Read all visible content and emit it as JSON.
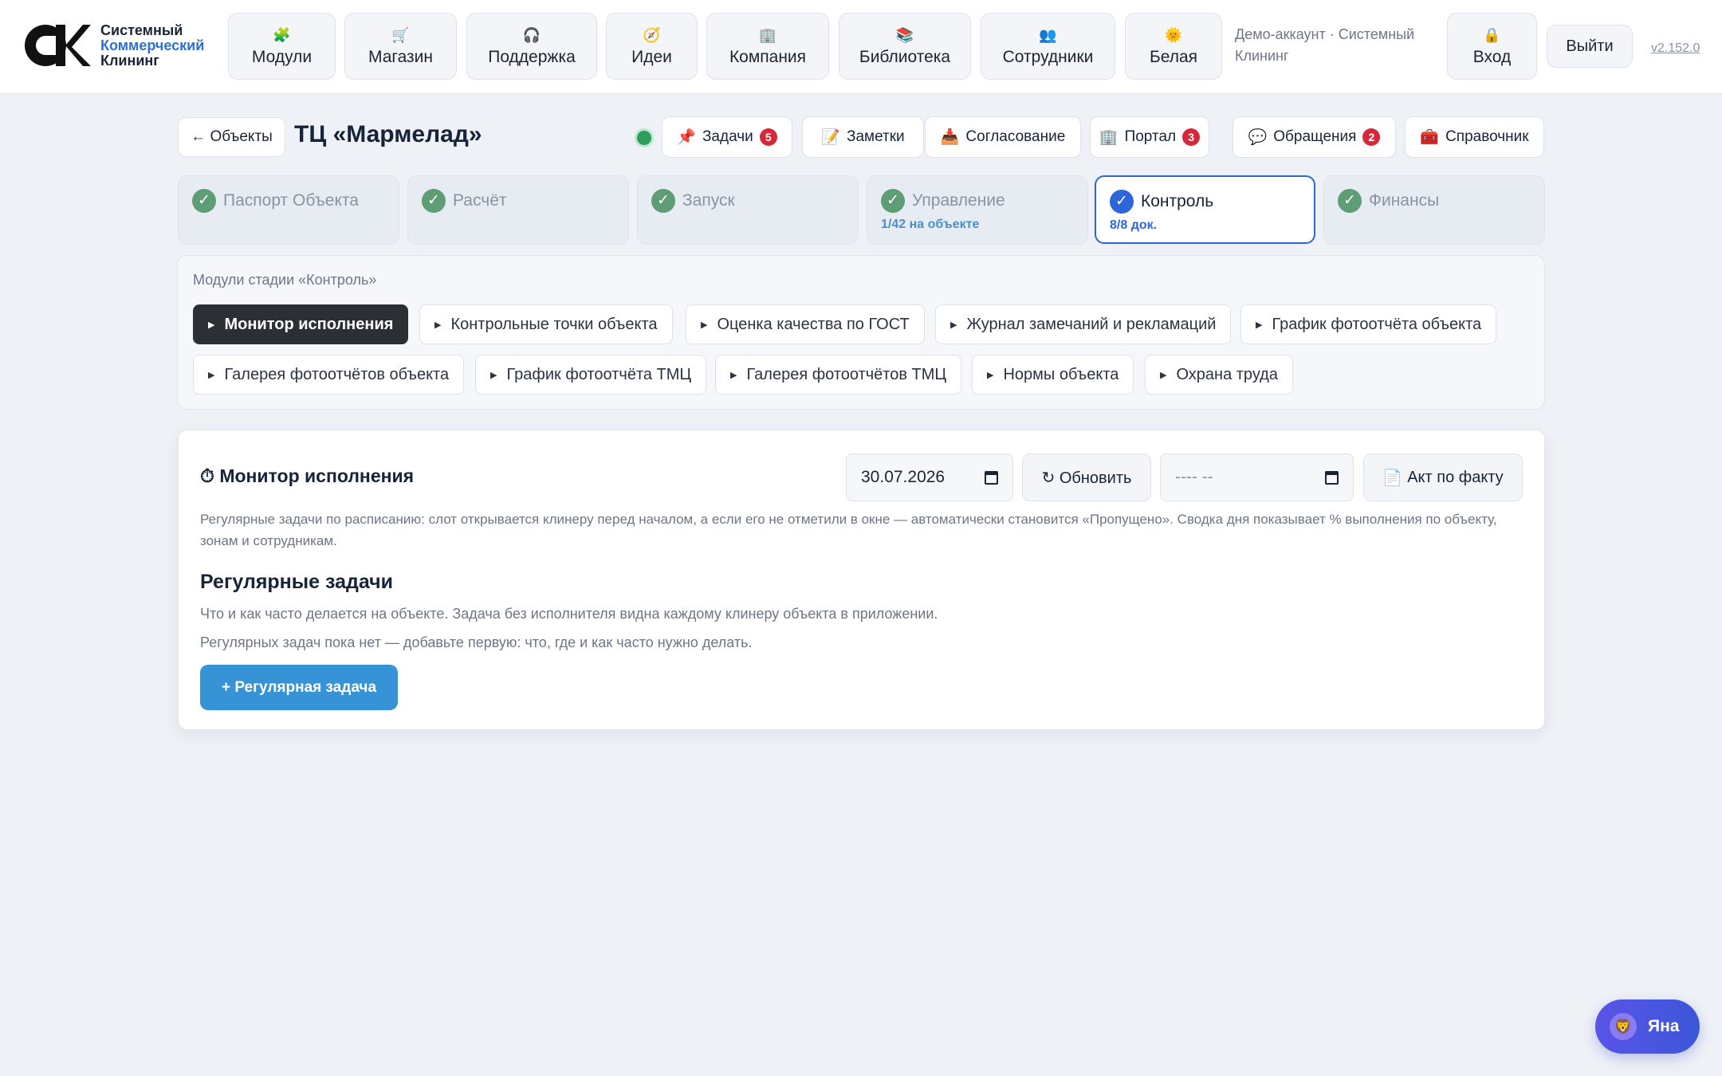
{
  "header": {
    "logo": {
      "line1": "Системный",
      "line2": "Коммерческий",
      "line3": "Клининг"
    },
    "nav": [
      {
        "label": "Модули",
        "icon": "🧩"
      },
      {
        "label": "Магазин",
        "icon": "🛒"
      },
      {
        "label": "Поддержка",
        "icon": "🎧"
      },
      {
        "label": "Идеи",
        "icon": "🧭"
      },
      {
        "label": "Компания",
        "icon": "🏢"
      },
      {
        "label": "Библиотека",
        "icon": "📚"
      },
      {
        "label": "Сотрудники",
        "icon": "👥"
      },
      {
        "label": "Белая",
        "icon": "🌞"
      }
    ],
    "demo_account": "Демо-аккаунт · Системный Клининг",
    "login": {
      "label": "Вход",
      "icon": "🔒"
    },
    "logout": "Выйти",
    "version": "v2.152.0"
  },
  "object": {
    "back_label": "← Объекты",
    "title": "ТЦ «Мармелад»",
    "status_color": "#2e9d5d",
    "quick": [
      {
        "label": "Задачи",
        "icon": "📌",
        "badge": "5"
      },
      {
        "label": "Заметки",
        "icon": "📝",
        "badge": ""
      },
      {
        "label": "Согласование",
        "icon": "📥",
        "badge": ""
      },
      {
        "label": "Портал",
        "icon": "🏢",
        "badge": "3"
      },
      {
        "label": "Обращения",
        "icon": "💬",
        "badge": "2"
      },
      {
        "label": "Справочник",
        "icon": "🧰",
        "badge": ""
      }
    ]
  },
  "stages": [
    {
      "label": "Паспорт Объекта",
      "sub": ""
    },
    {
      "label": "Расчёт",
      "sub": ""
    },
    {
      "label": "Запуск",
      "sub": ""
    },
    {
      "label": "Управление",
      "sub": "1/42 на объекте"
    },
    {
      "label": "Контроль",
      "sub": "8/8 док."
    },
    {
      "label": "Финансы",
      "sub": ""
    }
  ],
  "modules": {
    "caption": "Модули стадии «Контроль»",
    "chips": [
      "Монитор исполнения",
      "Контрольные точки объекта",
      "Оценка качества по ГОСТ",
      "Журнал замечаний и рекламаций",
      "График фотоотчёта объекта",
      "Галерея фотоотчётов объекта",
      "График фотоотчёта ТМЦ",
      "Галерея фотоотчётов ТМЦ",
      "Нормы объекта",
      "Охрана труда"
    ]
  },
  "monitor": {
    "title": "⏱ Монитор исполнения",
    "date_value": "30.07.2026",
    "refresh_label": "↻ Обновить",
    "month_placeholder": "---- --",
    "act_label": "Акт по факту",
    "act_icon": "📄",
    "description": "Регулярные задачи по расписанию: слот открывается клинеру перед началом, а если его не отметили в окне — автоматически становится «Пропущено». Сводка дня показывает % выполнения по объекту, зонам и сотрудникам.",
    "section_title": "Регулярные задачи",
    "section_text": "Что и как часто делается на объекте. Задача без исполнителя видна каждому клинеру объекта в приложении.",
    "empty_text": "Регулярных задач пока нет — добавьте первую: что, где и как часто нужно делать.",
    "add_label": "+ Регулярная задача"
  },
  "assistant": {
    "name": "Яна",
    "icon": "🦁"
  }
}
